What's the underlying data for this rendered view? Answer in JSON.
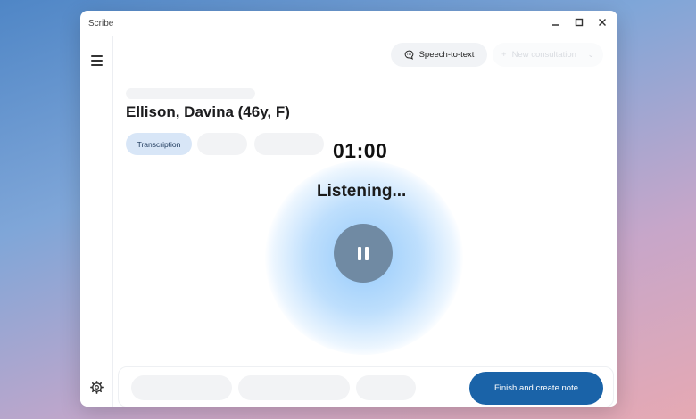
{
  "window": {
    "title": "Scribe",
    "controls": {
      "minimize": "—",
      "maximize": "☐",
      "close": "✕"
    }
  },
  "header": {
    "speech_to_text_label": "Speech-to-text",
    "new_consultation_label": "New consultation"
  },
  "patient": {
    "name": "Ellison, Davina (46y, F)"
  },
  "tabs": [
    {
      "label": "Transcription",
      "active": true
    }
  ],
  "recording": {
    "timer": "01:00",
    "status": "Listening..."
  },
  "footer": {
    "finish_label": "Finish and create note"
  },
  "colors": {
    "accent": "#1a63a8",
    "pause_button": "#708aa3",
    "tab_active_bg": "#d8e6f7",
    "glow": "#8fc7fa"
  },
  "icons": {
    "menu": "menu-icon",
    "settings": "settings-icon",
    "speech": "speech-bubble-icon",
    "plus": "plus-icon",
    "chevron": "chevron-down-icon",
    "pause": "pause-icon"
  }
}
